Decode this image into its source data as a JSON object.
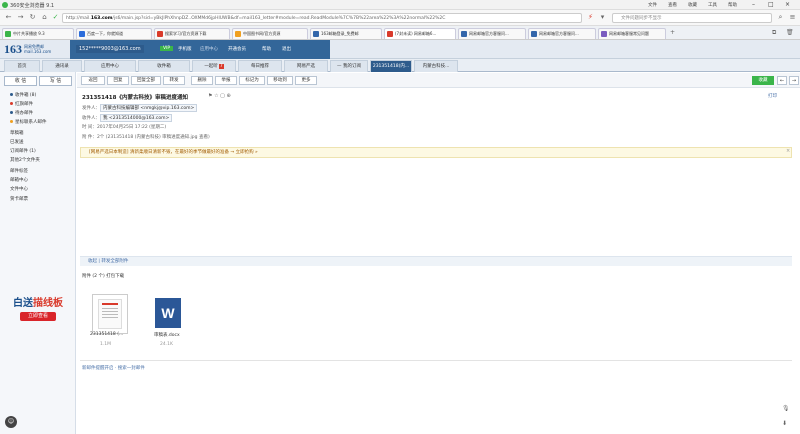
{
  "browser": {
    "title": "360安全浏览器 9.1",
    "menu": [
      "文件",
      "查看",
      "收藏",
      "工具",
      "帮助"
    ],
    "url_prefix": "http://mail.",
    "url_host": "163.com",
    "url_rest": "/js6/main.jsp?sid=yBkJlPhXhnpDZ..OXMMd6jpHlUWB&df=mail163_letter#module=read.ReadModule%7C%7B%22area%22%3A%22normal%22%2C",
    "search_placeholder": "文件问题同步不显示",
    "tabs": [
      {
        "label": "中片共享播放 9.3",
        "color": "#3bb54a"
      },
      {
        "label": "百度一下，你就知道",
        "color": "#2c6ddb"
      },
      {
        "label": "搜索学习/官方资源下载",
        "color": "#d93a2b"
      },
      {
        "label": "中国图书网/官方资源",
        "color": "#f0a020"
      },
      {
        "label": "163邮箱登录_免费邮",
        "color": "#3366aa"
      },
      {
        "label": "(7封未读) 网易邮箱6...",
        "color": "#d93a2b"
      },
      {
        "label": "网易邮箱官方客服问...",
        "color": "#3366aa"
      },
      {
        "label": "网易邮箱官方客服问...",
        "color": "#3366aa"
      },
      {
        "label": "网易邮箱客服常见问题",
        "color": "#7a5cc0"
      }
    ]
  },
  "mail": {
    "logo": "163",
    "logo_sub_1": "网易免费邮",
    "logo_sub_2": "mail.163.com",
    "user": "152*****9003@163.com",
    "header_links": [
      "VIP",
      "手机版",
      "应用中心",
      "开通会员",
      "帮助",
      "退出"
    ],
    "tabs": [
      "首页",
      "通讯录",
      "应用中心",
      "收件箱",
      "一起听",
      "每日推荐",
      "网易严选",
      "— 我的订阅",
      "231351418(内...",
      "内蒙古科技..."
    ],
    "active_tab": "231351418(内...",
    "unread_badge": "7"
  },
  "sidebar": {
    "receive": "收 信",
    "compose": "写 信",
    "folders": [
      {
        "label": "收件箱 (8)",
        "dot": "#2d5b8c"
      },
      {
        "label": "红旗邮件",
        "dot": "#d93a2b"
      },
      {
        "label": "待办邮件",
        "dot": "#2d5b8c"
      },
      {
        "label": "星标联系人邮件",
        "dot": "#f0a020"
      },
      {
        "label": "草稿箱",
        "dot": ""
      },
      {
        "label": "已发送",
        "dot": ""
      },
      {
        "label": "订阅邮件 (1)",
        "dot": ""
      },
      {
        "label": "其他2个文件夹",
        "dot": ""
      },
      {
        "label": "邮件标签",
        "dot": ""
      },
      {
        "label": "邮箱中心",
        "dot": ""
      },
      {
        "label": "文件中心",
        "dot": ""
      },
      {
        "label": "贺卡邮票",
        "dot": ""
      }
    ],
    "ad_title": "白送",
    "ad_title2": "描线板",
    "ad_button": "立即查看"
  },
  "toolbar": {
    "buttons": [
      "返回",
      "回复",
      "回复全部",
      "转发",
      "删除",
      "举报",
      "标记为",
      "移动到",
      "更多"
    ],
    "prev": "←",
    "next": "→",
    "settings": "⚙",
    "collect": "收藏",
    "print": "打印"
  },
  "message": {
    "subject": "231351418《内蒙古科技》审稿进度通知",
    "sender_label": "发件人：",
    "sender": "内蒙古科技编辑部 <nmgkj@vip.163.com>",
    "to_label": "收件人：",
    "to": "我 <2313514000@163.com>",
    "time_label": "时 间：",
    "time": "2017年04月25日 17:22 (星期二)",
    "attach_label": "附 件：",
    "attach_summary": "2个 (231351418 (内蒙古科技) 审稿进度通知.jpg 查看)",
    "notice": "[网易严选日本制造] 清新柔顺日清新不毁，在最好的季节做最好的准备 → 立即抢购 »",
    "quote_links": "收起 | 转发全部附件",
    "attach_head": "附件 (2 个) 打包下载",
    "attachments": [
      {
        "name": "231351418 (...",
        "size": "1.1M"
      },
      {
        "name": "审稿表.docx",
        "size": "24.1K"
      }
    ],
    "footer": "新邮件提醒开启  ·  搜索一封邮件"
  }
}
